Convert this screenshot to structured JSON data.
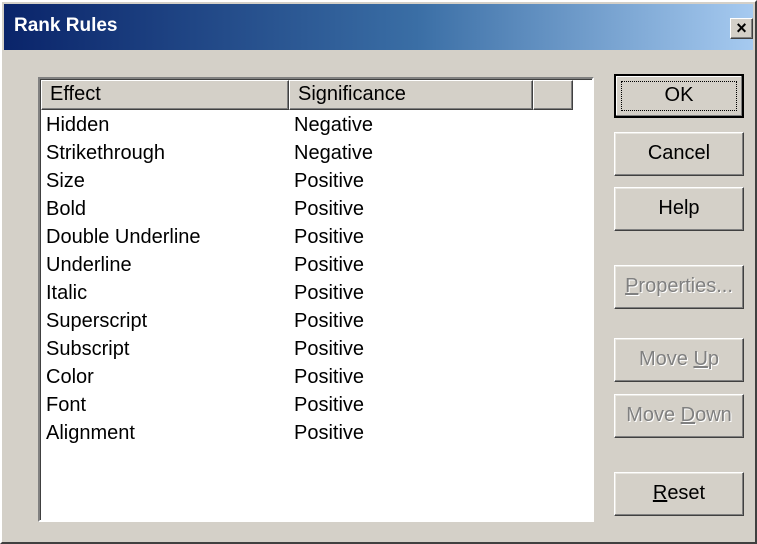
{
  "window": {
    "title": "Rank Rules",
    "close_glyph": "×"
  },
  "list": {
    "columns": [
      "Effect",
      "Significance"
    ],
    "rows": [
      {
        "effect": "Hidden",
        "significance": "Negative"
      },
      {
        "effect": "Strikethrough",
        "significance": "Negative"
      },
      {
        "effect": "Size",
        "significance": "Positive"
      },
      {
        "effect": "Bold",
        "significance": "Positive"
      },
      {
        "effect": "Double Underline",
        "significance": "Positive"
      },
      {
        "effect": "Underline",
        "significance": "Positive"
      },
      {
        "effect": "Italic",
        "significance": "Positive"
      },
      {
        "effect": "Superscript",
        "significance": "Positive"
      },
      {
        "effect": "Subscript",
        "significance": "Positive"
      },
      {
        "effect": "Color",
        "significance": "Positive"
      },
      {
        "effect": "Font",
        "significance": "Positive"
      },
      {
        "effect": "Alignment",
        "significance": "Positive"
      }
    ]
  },
  "buttons": {
    "ok": "OK",
    "cancel": "Cancel",
    "help": "Help",
    "properties": {
      "accel": "P",
      "rest": "roperties..."
    },
    "move_up": {
      "pre": "Move ",
      "accel": "U",
      "rest": "p"
    },
    "move_down": {
      "pre": "Move ",
      "accel": "D",
      "rest": "own"
    },
    "reset": {
      "accel": "R",
      "rest": "eset"
    }
  }
}
